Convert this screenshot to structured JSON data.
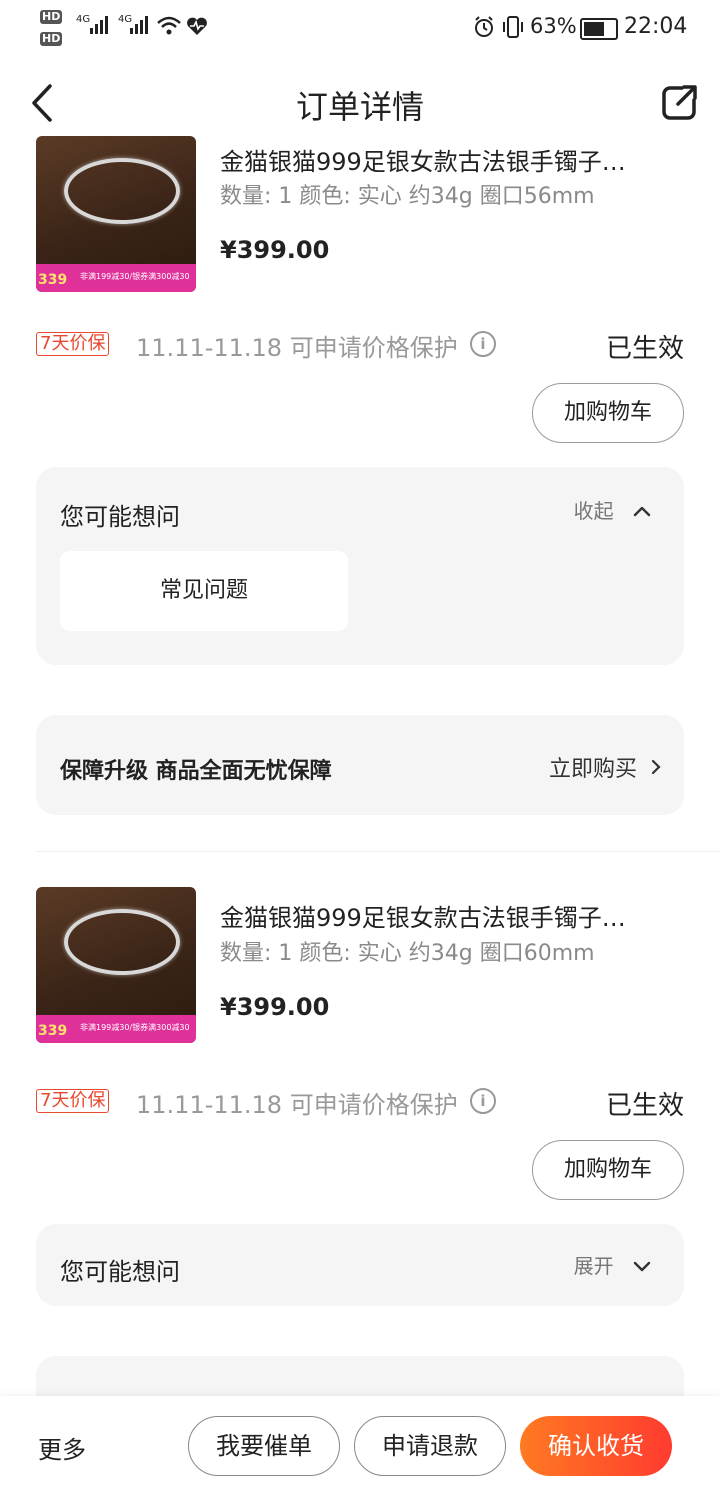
{
  "status_bar": {
    "hd1": "HD",
    "hd2": "HD",
    "signal1": "4G",
    "signal2": "4G",
    "battery": "63%",
    "time": "22:04"
  },
  "header": {
    "title": "订单详情"
  },
  "products": [
    {
      "title": "金猫银猫999足银女款古法银手镯子…",
      "spec": "数量: 1   颜色: 实心 约34g 圈口56mm",
      "price": "¥399.00",
      "thumb_price": "339",
      "thumb_promo": "非满199减30/银券满300减30",
      "price_tag": "7天价保",
      "price_protect": "11.11-11.18 可申请价格保护",
      "status": "已生效",
      "add_cart": "加购物车"
    },
    {
      "title": "金猫银猫999足银女款古法银手镯子…",
      "spec": "数量: 1   颜色: 实心 约34g 圈口60mm",
      "price": "¥399.00",
      "thumb_price": "339",
      "thumb_promo": "非满199减30/银券满300减30",
      "price_tag": "7天价保",
      "price_protect": "11.11-11.18 可申请价格保护",
      "status": "已生效",
      "add_cart": "加购物车"
    }
  ],
  "faq": {
    "title": "您可能想问",
    "collapse_label": "收起",
    "expand_label": "展开",
    "item": "常见问题"
  },
  "upgrade": {
    "title": "保障升级  商品全面无忧保障",
    "buy_now": "立即购买"
  },
  "bottom_bar": {
    "more": "更多",
    "urge": "我要催单",
    "refund": "申请退款",
    "confirm": "确认收货"
  },
  "colors": {
    "accent": "#ff4a2a",
    "tag": "#e8482f",
    "card_bg": "#f5f5f5"
  }
}
